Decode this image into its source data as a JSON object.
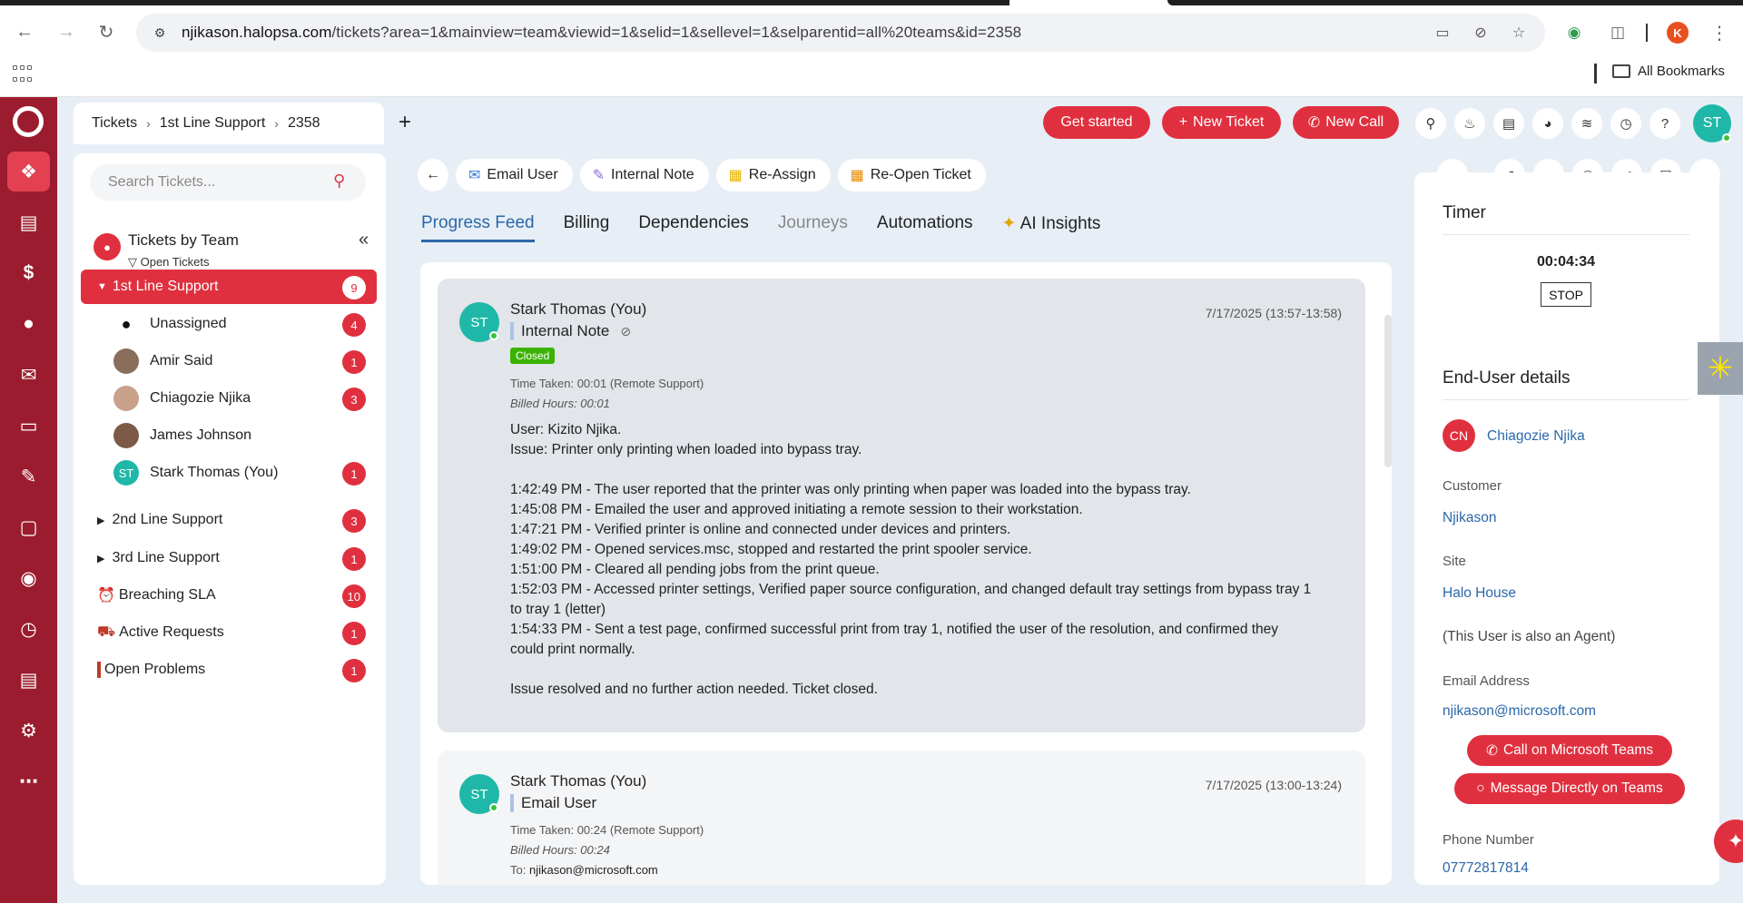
{
  "browser": {
    "url_host": "njikason.halopsa.com",
    "url_path": "/tickets?area=1&mainview=team&viewid=1&selid=1&sellevel=1&selparentid=all%20teams&id=2358",
    "profile_initial": "K",
    "bookmarks_label": "All Bookmarks"
  },
  "rail": {
    "icons": [
      "halo-logo-icon",
      "tickets-icon",
      "briefcase-icon",
      "dollar-icon",
      "user-icon",
      "campaign-icon",
      "device-icon",
      "edit-icon",
      "document-icon",
      "moneybag-icon",
      "clock-icon",
      "report-icon",
      "settings-icon",
      "more-icon"
    ]
  },
  "header": {
    "breadcrumb": [
      "Tickets",
      "1st Line Support",
      "2358"
    ],
    "get_started": "Get started",
    "new_ticket": "New Ticket",
    "new_call": "New Call",
    "avatar": "ST"
  },
  "left": {
    "search_placeholder": "Search Tickets...",
    "view_title": "Tickets by Team",
    "view_sub": "Open Tickets",
    "tree": {
      "first_line": {
        "label": "1st Line Support",
        "count": "9"
      },
      "unassigned": {
        "label": "Unassigned",
        "count": "4"
      },
      "amir": {
        "label": "Amir Said",
        "count": "1"
      },
      "chiagozie": {
        "label": "Chiagozie Njika",
        "count": "3"
      },
      "james": {
        "label": "James Johnson",
        "count": ""
      },
      "stark": {
        "label": "Stark Thomas (You)",
        "count": "1",
        "initials": "ST"
      },
      "second_line": {
        "label": "2nd Line Support",
        "count": "3"
      },
      "third_line": {
        "label": "3rd Line Support",
        "count": "1"
      },
      "breaching": {
        "label": "Breaching SLA",
        "count": "10"
      },
      "active": {
        "label": "Active Requests",
        "count": "1"
      },
      "problems": {
        "label": "Open Problems",
        "count": "1"
      }
    }
  },
  "actions": {
    "email_user": "Email User",
    "internal_note": "Internal Note",
    "reassign": "Re-Assign",
    "reopen": "Re-Open Ticket"
  },
  "tabs": [
    "Progress Feed",
    "Billing",
    "Dependencies",
    "Journeys",
    "Automations",
    "AI Insights"
  ],
  "feed": {
    "entry1": {
      "initials": "ST",
      "author": "Stark Thomas (You)",
      "type": "Internal Note",
      "date": "7/17/2025 (13:57-13:58)",
      "status": "Closed",
      "time_taken": "Time Taken: 00:01 (Remote Support)",
      "billed": "Billed Hours: 00:01",
      "lines": [
        "User: Kizito Njika.",
        "Issue: Printer only printing when loaded into bypass tray.",
        "1:42:49 PM - The user reported that the printer was only printing when paper was loaded into the bypass tray.",
        "1:45:08 PM - Emailed the user and approved initiating a remote session to their workstation.",
        "1:47:21 PM - Verified printer is online and connected under devices and printers.",
        "1:49:02 PM - Opened services.msc, stopped and restarted the print spooler service.",
        "1:51:00 PM - Cleared all pending jobs from the print queue.",
        "1:52:03 PM - Accessed printer settings, Verified paper source configuration, and changed default tray settings from bypass tray 1",
        "to tray 1 (letter)",
        "1:54:33 PM - Sent a test page, confirmed successful print from tray 1, notified the user of the resolution, and confirmed they",
        "could print normally.",
        "Issue resolved and no further action needed. Ticket closed."
      ]
    },
    "entry2": {
      "initials": "ST",
      "author": "Stark Thomas (You)",
      "type": "Email User",
      "date": "7/17/2025 (13:00-13:24)",
      "time_taken": "Time Taken: 00:24 (Remote Support)",
      "billed": "Billed Hours: 00:24",
      "to_label": "To:",
      "to": "njikason@microsoft.com"
    }
  },
  "right": {
    "timer_title": "Timer",
    "timer_value": "00:04:34",
    "stop_label": "STOP",
    "enduser_title": "End-User details",
    "user_initials": "CN",
    "user_name": "Chiagozie Njika",
    "customer_label": "Customer",
    "customer": "Njikason",
    "site_label": "Site",
    "site": "Halo House",
    "agent_note": "(This User is also an Agent)",
    "email_label": "Email Address",
    "email": "njikason@microsoft.com",
    "call_teams": "Call on Microsoft Teams",
    "message_teams": "Message Directly on Teams",
    "phone_label": "Phone Number",
    "phone": "07772817814"
  }
}
